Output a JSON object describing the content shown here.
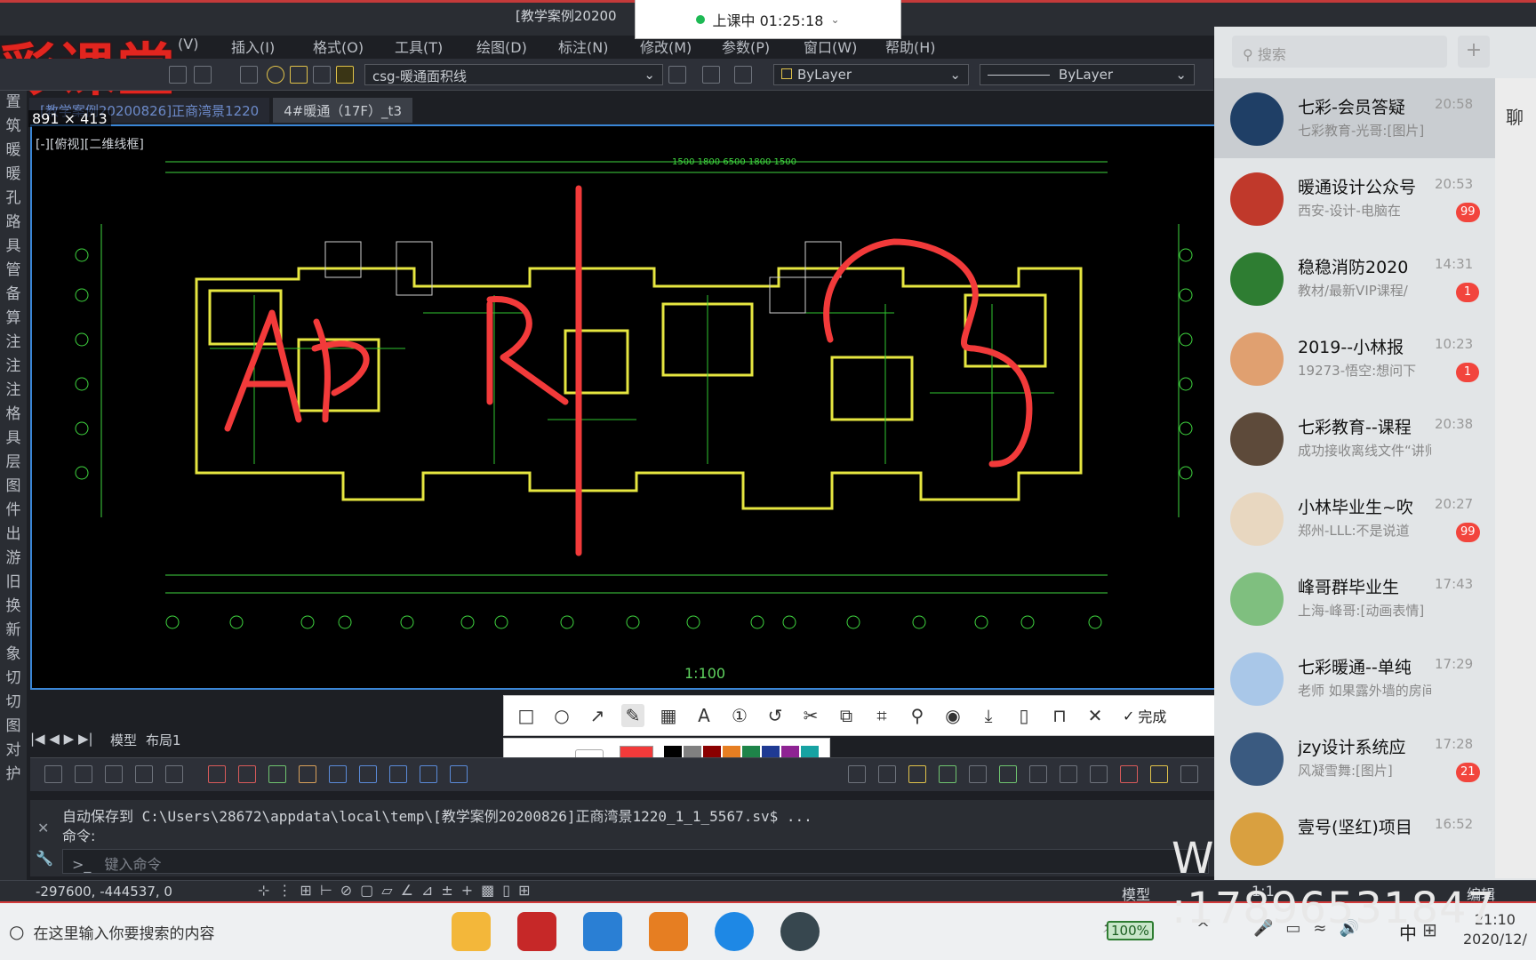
{
  "window": {
    "title": "[教学案例20200",
    "live_status": "上课中 01:25:18",
    "brand": "彩课堂"
  },
  "menu": [
    "(V)",
    "插入(I)",
    "格式(O)",
    "工具(T)",
    "绘图(D)",
    "标注(N)",
    "修改(M)",
    "参数(P)",
    "窗口(W)",
    "帮助(H)"
  ],
  "toolbar": {
    "layer": "csg-暖通面积线",
    "color": "ByLayer",
    "linetype": "ByLayer"
  },
  "left_strip": [
    "置",
    "筑",
    "暖",
    "暖",
    "孔",
    "路",
    "具",
    "管",
    "备",
    "算",
    "注",
    "注",
    "注",
    "格",
    "具",
    "层",
    "图",
    "件",
    "出",
    "游",
    "旧",
    "换",
    "新",
    "象",
    "切",
    "切",
    "图",
    "对",
    "护"
  ],
  "tabs": [
    {
      "label": "[教学案例20200826]正商湾景1220",
      "active": true
    },
    {
      "label": "4#暖通（17F）_t3",
      "active": false
    }
  ],
  "canvas": {
    "size_badge": "891 × 413",
    "view_label": "[-][俯视][二维线框]",
    "scale_label": "1:100",
    "handwriting": "Ap Rl"
  },
  "annotation_tools": [
    "rectangle",
    "circle",
    "arrow",
    "pen",
    "mosaic",
    "text",
    "number",
    "undo",
    "cut",
    "copy",
    "ocr",
    "pin",
    "record",
    "download",
    "save",
    "bookmark",
    "close"
  ],
  "annotation_done": "完成",
  "palette": {
    "sizes": [
      "small",
      "medium",
      "large"
    ],
    "current_color": "#f23a3a",
    "swatches": [
      "#000000",
      "#808080",
      "#8b0000",
      "#e67e22",
      "#1e8449",
      "#1f3a93",
      "#8e2393",
      "#17a2a2",
      "#ffffff",
      "#c0c0c0",
      "#e74c3c",
      "#f1c40f",
      "#2ecc40",
      "#3498db",
      "#ff33cc",
      "#2ee6e6"
    ]
  },
  "layout_tabs": [
    "模型",
    "布局1"
  ],
  "command": {
    "autosave": "自动保存到 C:\\Users\\28672\\appdata\\local\\temp\\[教学案例20200826]正商湾景1220_1_1_5567.sv$ ...",
    "prompt": "命令:",
    "placeholder": "键入命令"
  },
  "status": {
    "coords": "-297600, -444537, 0",
    "model": "模型",
    "scale": "1:1",
    "edit": "编辑"
  },
  "taskbar": {
    "search_placeholder": "在这里输入你要搜索的内容",
    "battery": "100%",
    "ime": "中",
    "time": "21:10",
    "date": "2020/12/"
  },
  "chat": {
    "search_placeholder": "搜索",
    "plus": "+",
    "items": [
      {
        "name": "七彩-会员答疑",
        "msg": "七彩教育-光哥:[图片]",
        "time": "20:58",
        "badge": "",
        "color": "#1f3f66",
        "active": true
      },
      {
        "name": "暖通设计公众号",
        "msg": "西安-设计-电脑在",
        "time": "20:53",
        "badge": "99",
        "color": "#c0392b",
        "active": false
      },
      {
        "name": "稳稳消防2020",
        "msg": "教材/最新VIP课程/",
        "time": "14:31",
        "badge": "1",
        "color": "#2e7d32",
        "active": false
      },
      {
        "name": "2019--小林报",
        "msg": "19273-悟空:想问下",
        "time": "10:23",
        "badge": "1",
        "color": "#e0a070",
        "active": false
      },
      {
        "name": "七彩教育--课程",
        "msg": "成功接收离线文件“讲师",
        "time": "20:38",
        "badge": "",
        "color": "#5d4a3a",
        "active": false
      },
      {
        "name": "小林毕业生~吹",
        "msg": "郑州-LLL:不是说道",
        "time": "20:27",
        "badge": "99",
        "color": "#e8d7c0",
        "active": false
      },
      {
        "name": "峰哥群毕业生",
        "msg": "上海-峰哥:[动画表情]",
        "time": "17:43",
        "badge": "",
        "color": "#7fbf7f",
        "active": false
      },
      {
        "name": "七彩暖通--单纯",
        "msg": "老师  如果露外墙的房间",
        "time": "17:29",
        "badge": "",
        "color": "#a9c7e8",
        "active": false
      },
      {
        "name": "jzy设计系统应",
        "msg": "风凝雪舞:[图片]",
        "time": "17:28",
        "badge": "21",
        "color": "#3a5a80",
        "active": false
      },
      {
        "name": "壹号(坚红)项目",
        "msg": "",
        "time": "16:52",
        "badge": "",
        "color": "#d9a040",
        "active": false
      }
    ],
    "side_tab": "聊"
  },
  "watermark": "W  :17896531847"
}
